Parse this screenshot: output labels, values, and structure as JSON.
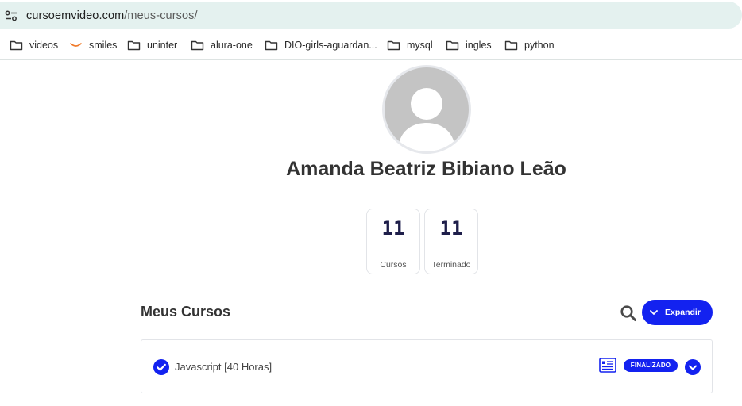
{
  "browser": {
    "url_host": "cursoemvideo.com",
    "url_path": "/meus-cursos/",
    "site_icon": "site-settings-icon",
    "bookmarks": [
      {
        "label": "videos",
        "icon": "folder-icon"
      },
      {
        "label": "smiles",
        "icon": "smiles-logo-icon"
      },
      {
        "label": "uninter",
        "icon": "folder-icon"
      },
      {
        "label": "alura-one",
        "icon": "folder-icon"
      },
      {
        "label": "DIO-girls-aguardan...",
        "icon": "folder-icon"
      },
      {
        "label": "mysql",
        "icon": "folder-icon"
      },
      {
        "label": "ingles",
        "icon": "folder-icon"
      },
      {
        "label": "python",
        "icon": "folder-icon"
      }
    ]
  },
  "profile": {
    "avatar": "default-avatar-icon",
    "name": "Amanda Beatriz Bibiano Leão",
    "stats": [
      {
        "value": "11",
        "label": "Cursos"
      },
      {
        "value": "11",
        "label": "Terminado"
      }
    ]
  },
  "courses": {
    "title": "Meus Cursos",
    "search_icon": "search-icon",
    "expand_label": "Expandir",
    "items": [
      {
        "name": "Javascript [40 Horas]",
        "status": "FINALIZADO",
        "icons": [
          "check-circle-icon",
          "certificate-icon",
          "chevron-down-icon"
        ]
      }
    ]
  },
  "colors": {
    "accent": "#1322f0",
    "address_bar": "#e4f1ef",
    "avatar_bg": "#c4c4c4",
    "title_text": "#333333"
  }
}
